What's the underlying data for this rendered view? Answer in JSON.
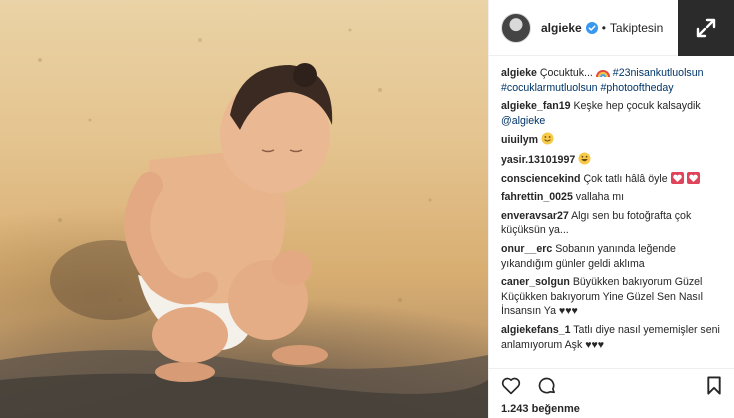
{
  "post": {
    "username": "algieke",
    "follow_state": "Takiptesin",
    "separator": "•",
    "caption": {
      "author": "algieke",
      "text": "Çocuktuk...",
      "hashtags_line1": "#23nisankutluolsun",
      "hashtags_line2": "#cocuklarmutluolsun #photooftheday"
    },
    "comments": [
      {
        "author": "algieke_fan19",
        "text": "Keşke hep çocuk kalsaydik",
        "mention": "@algieke"
      },
      {
        "author": "uiuilym",
        "text": ""
      },
      {
        "author": "yasir.13101997",
        "text": ""
      },
      {
        "author": "consciencekind",
        "text": "Çok tatlı hâlâ öyle"
      },
      {
        "author": "fahrettin_0025",
        "text": "vallaha mı"
      },
      {
        "author": "enveravsar27",
        "text": "Algı sen bu fotoğrafta çok küçüksün ya..."
      },
      {
        "author": "onur__erc",
        "text": "Sobanın yanında leğende yıkandığım günler geldi aklıma"
      },
      {
        "author": "caner_solgun",
        "text": "Büyükken bakıyorum Güzel Küçükken bakıyorum Yine Güzel Sen Nasıl İnsansın Ya ♥♥♥"
      },
      {
        "author": "algiekefans_1",
        "text": "Tatlı diye nasıl yememişler seni anlamıyorum Aşk ♥♥♥"
      }
    ],
    "likes_count": "1.243",
    "likes_label": "beğenme",
    "icons": {
      "verified": "verified-badge-icon",
      "expand": "expand-icon",
      "like": "heart-icon",
      "comment": "comment-icon",
      "save": "bookmark-icon"
    },
    "colors": {
      "verified": "#3897f0",
      "hashtag": "#003569",
      "expand_bg": "#2b2b2b"
    }
  }
}
